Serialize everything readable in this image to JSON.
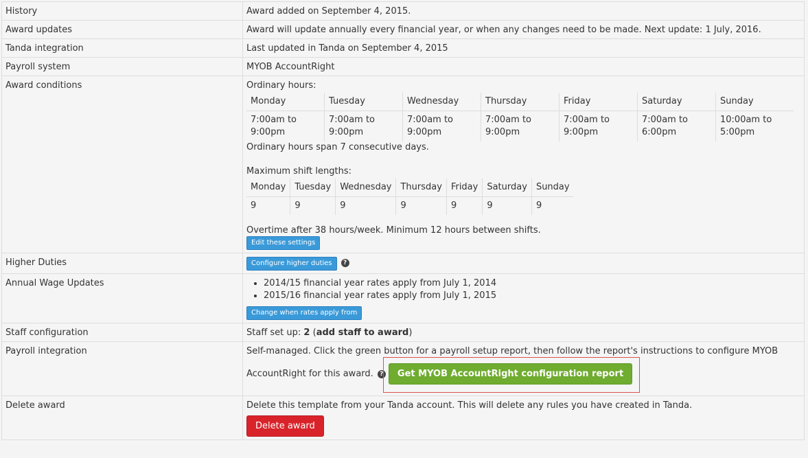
{
  "rows": {
    "history": {
      "label": "History",
      "value": "Award added on September 4, 2015."
    },
    "award_updates": {
      "label": "Award updates",
      "value": "Award will update annually every financial year, or when any changes need to be made. Next update: 1 July, 2016."
    },
    "tanda_integration": {
      "label": "Tanda integration",
      "value": "Last updated in Tanda on September 4, 2015"
    },
    "payroll_system": {
      "label": "Payroll system",
      "value": "MYOB AccountRight"
    },
    "award_conditions": {
      "label": "Award conditions",
      "ordinary_title": "Ordinary hours:",
      "days": [
        "Monday",
        "Tuesday",
        "Wednesday",
        "Thursday",
        "Friday",
        "Saturday",
        "Sunday"
      ],
      "ordinary_hours": [
        "7:00am to 9:00pm",
        "7:00am to 9:00pm",
        "7:00am to 9:00pm",
        "7:00am to 9:00pm",
        "7:00am to 9:00pm",
        "7:00am to 6:00pm",
        "10:00am to 5:00pm"
      ],
      "span_text": "Ordinary hours span 7 consecutive days.",
      "max_title": "Maximum shift lengths:",
      "max_lengths": [
        "9",
        "9",
        "9",
        "9",
        "9",
        "9",
        "9"
      ],
      "overtime_text": "Overtime after 38 hours/week. Minimum 12 hours between shifts.",
      "edit_button": "Edit these settings"
    },
    "higher_duties": {
      "label": "Higher Duties",
      "button": "Configure higher duties",
      "help": "?"
    },
    "annual_wage": {
      "label": "Annual Wage Updates",
      "items": [
        "2014/15 financial year rates apply from July 1, 2014",
        "2015/16 financial year rates apply from July 1, 2015"
      ],
      "button": "Change when rates apply from"
    },
    "staff_config": {
      "label": "Staff configuration",
      "prefix": "Staff set up: ",
      "count": "2",
      "link": "add staff to award"
    },
    "payroll_integration": {
      "label": "Payroll integration",
      "text": "Self-managed. Click the green button for a payroll setup report, then follow the report's instructions to configure MYOB AccountRight for this award.",
      "help": "?",
      "button": "Get MYOB AccountRight configuration report"
    },
    "delete_award": {
      "label": "Delete award",
      "text": "Delete this template from your Tanda account. This will delete any rules you have created in Tanda.",
      "button": "Delete award"
    }
  }
}
